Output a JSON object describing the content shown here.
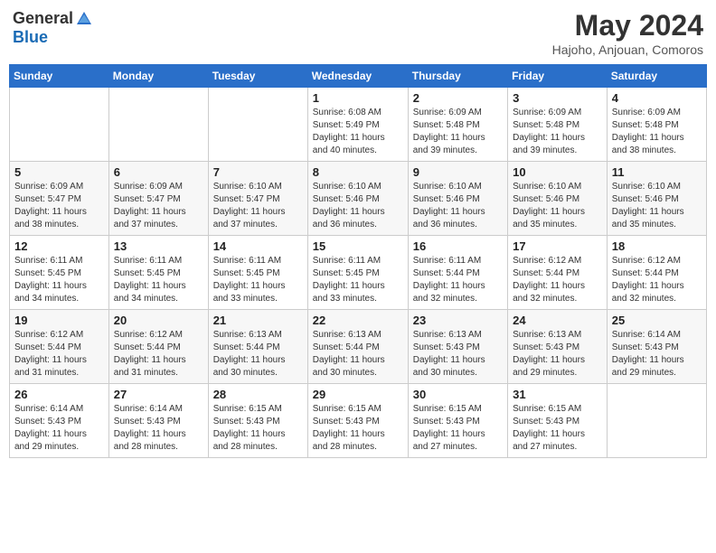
{
  "logo": {
    "general": "General",
    "blue": "Blue"
  },
  "title": "May 2024",
  "location": "Hajoho, Anjouan, Comoros",
  "days_of_week": [
    "Sunday",
    "Monday",
    "Tuesday",
    "Wednesday",
    "Thursday",
    "Friday",
    "Saturday"
  ],
  "weeks": [
    [
      {
        "day": "",
        "info": ""
      },
      {
        "day": "",
        "info": ""
      },
      {
        "day": "",
        "info": ""
      },
      {
        "day": "1",
        "info": "Sunrise: 6:08 AM\nSunset: 5:49 PM\nDaylight: 11 hours\nand 40 minutes."
      },
      {
        "day": "2",
        "info": "Sunrise: 6:09 AM\nSunset: 5:48 PM\nDaylight: 11 hours\nand 39 minutes."
      },
      {
        "day": "3",
        "info": "Sunrise: 6:09 AM\nSunset: 5:48 PM\nDaylight: 11 hours\nand 39 minutes."
      },
      {
        "day": "4",
        "info": "Sunrise: 6:09 AM\nSunset: 5:48 PM\nDaylight: 11 hours\nand 38 minutes."
      }
    ],
    [
      {
        "day": "5",
        "info": "Sunrise: 6:09 AM\nSunset: 5:47 PM\nDaylight: 11 hours\nand 38 minutes."
      },
      {
        "day": "6",
        "info": "Sunrise: 6:09 AM\nSunset: 5:47 PM\nDaylight: 11 hours\nand 37 minutes."
      },
      {
        "day": "7",
        "info": "Sunrise: 6:10 AM\nSunset: 5:47 PM\nDaylight: 11 hours\nand 37 minutes."
      },
      {
        "day": "8",
        "info": "Sunrise: 6:10 AM\nSunset: 5:46 PM\nDaylight: 11 hours\nand 36 minutes."
      },
      {
        "day": "9",
        "info": "Sunrise: 6:10 AM\nSunset: 5:46 PM\nDaylight: 11 hours\nand 36 minutes."
      },
      {
        "day": "10",
        "info": "Sunrise: 6:10 AM\nSunset: 5:46 PM\nDaylight: 11 hours\nand 35 minutes."
      },
      {
        "day": "11",
        "info": "Sunrise: 6:10 AM\nSunset: 5:46 PM\nDaylight: 11 hours\nand 35 minutes."
      }
    ],
    [
      {
        "day": "12",
        "info": "Sunrise: 6:11 AM\nSunset: 5:45 PM\nDaylight: 11 hours\nand 34 minutes."
      },
      {
        "day": "13",
        "info": "Sunrise: 6:11 AM\nSunset: 5:45 PM\nDaylight: 11 hours\nand 34 minutes."
      },
      {
        "day": "14",
        "info": "Sunrise: 6:11 AM\nSunset: 5:45 PM\nDaylight: 11 hours\nand 33 minutes."
      },
      {
        "day": "15",
        "info": "Sunrise: 6:11 AM\nSunset: 5:45 PM\nDaylight: 11 hours\nand 33 minutes."
      },
      {
        "day": "16",
        "info": "Sunrise: 6:11 AM\nSunset: 5:44 PM\nDaylight: 11 hours\nand 32 minutes."
      },
      {
        "day": "17",
        "info": "Sunrise: 6:12 AM\nSunset: 5:44 PM\nDaylight: 11 hours\nand 32 minutes."
      },
      {
        "day": "18",
        "info": "Sunrise: 6:12 AM\nSunset: 5:44 PM\nDaylight: 11 hours\nand 32 minutes."
      }
    ],
    [
      {
        "day": "19",
        "info": "Sunrise: 6:12 AM\nSunset: 5:44 PM\nDaylight: 11 hours\nand 31 minutes."
      },
      {
        "day": "20",
        "info": "Sunrise: 6:12 AM\nSunset: 5:44 PM\nDaylight: 11 hours\nand 31 minutes."
      },
      {
        "day": "21",
        "info": "Sunrise: 6:13 AM\nSunset: 5:44 PM\nDaylight: 11 hours\nand 30 minutes."
      },
      {
        "day": "22",
        "info": "Sunrise: 6:13 AM\nSunset: 5:44 PM\nDaylight: 11 hours\nand 30 minutes."
      },
      {
        "day": "23",
        "info": "Sunrise: 6:13 AM\nSunset: 5:43 PM\nDaylight: 11 hours\nand 30 minutes."
      },
      {
        "day": "24",
        "info": "Sunrise: 6:13 AM\nSunset: 5:43 PM\nDaylight: 11 hours\nand 29 minutes."
      },
      {
        "day": "25",
        "info": "Sunrise: 6:14 AM\nSunset: 5:43 PM\nDaylight: 11 hours\nand 29 minutes."
      }
    ],
    [
      {
        "day": "26",
        "info": "Sunrise: 6:14 AM\nSunset: 5:43 PM\nDaylight: 11 hours\nand 29 minutes."
      },
      {
        "day": "27",
        "info": "Sunrise: 6:14 AM\nSunset: 5:43 PM\nDaylight: 11 hours\nand 28 minutes."
      },
      {
        "day": "28",
        "info": "Sunrise: 6:15 AM\nSunset: 5:43 PM\nDaylight: 11 hours\nand 28 minutes."
      },
      {
        "day": "29",
        "info": "Sunrise: 6:15 AM\nSunset: 5:43 PM\nDaylight: 11 hours\nand 28 minutes."
      },
      {
        "day": "30",
        "info": "Sunrise: 6:15 AM\nSunset: 5:43 PM\nDaylight: 11 hours\nand 27 minutes."
      },
      {
        "day": "31",
        "info": "Sunrise: 6:15 AM\nSunset: 5:43 PM\nDaylight: 11 hours\nand 27 minutes."
      },
      {
        "day": "",
        "info": ""
      }
    ]
  ]
}
